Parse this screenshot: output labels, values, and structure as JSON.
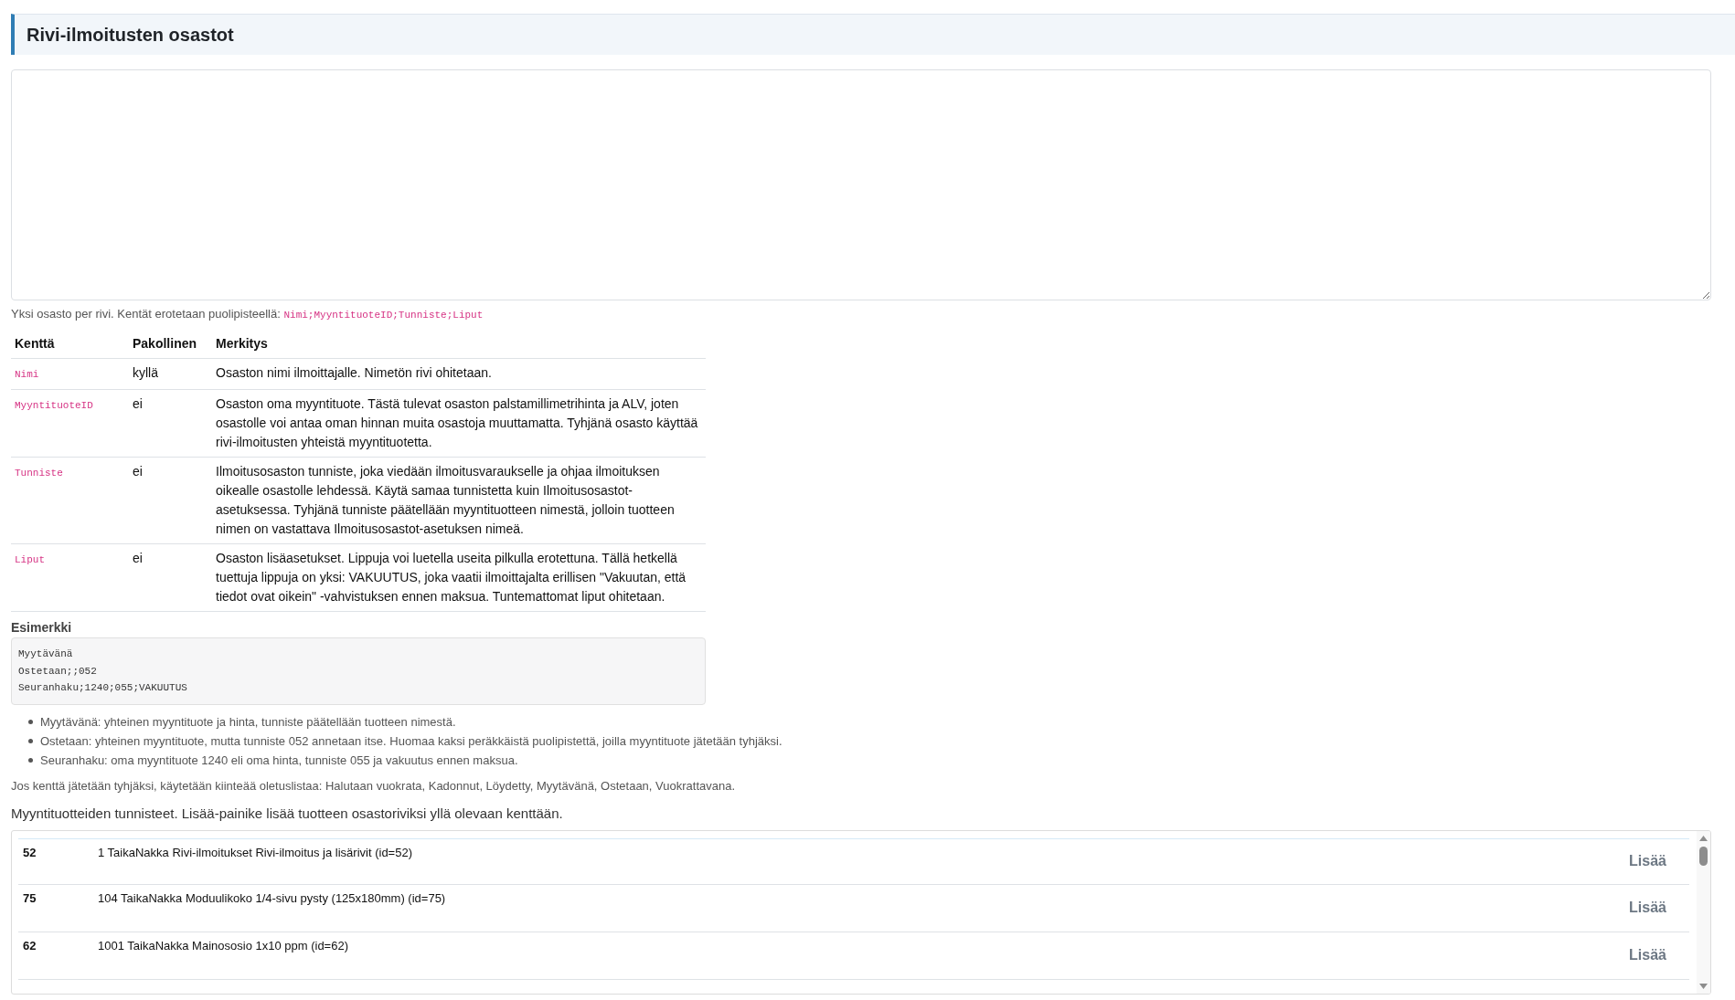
{
  "header": {
    "title": "Rivi-ilmoitusten osastot"
  },
  "help": {
    "text": "Yksi osasto per rivi. Kentät erotetaan puolipisteellä:",
    "code": "Nimi;MyyntituoteID;Tunniste;Liput"
  },
  "fields_table": {
    "columns": [
      "Kenttä",
      "Pakollinen",
      "Merkitys"
    ],
    "rows": [
      {
        "field": "Nimi",
        "required": "kyllä",
        "meaning": "Osaston nimi ilmoittajalle. Nimetön rivi ohitetaan."
      },
      {
        "field": "MyyntituoteID",
        "required": "ei",
        "meaning": "Osaston oma myyntituote. Tästä tulevat osaston palstamillimetrihinta ja ALV, joten osastolle voi antaa oman hinnan muita osastoja muuttamatta. Tyhjänä osasto käyttää rivi-ilmoitusten yhteistä myyntituotetta."
      },
      {
        "field": "Tunniste",
        "required": "ei",
        "meaning": "Ilmoitusosaston tunniste, joka viedään ilmoitusvaraukselle ja ohjaa ilmoituksen oikealle osastolle lehdessä. Käytä samaa tunnistetta kuin Ilmoitusosastot-asetuksessa. Tyhjänä tunniste päätellään myyntituotteen nimestä, jolloin tuotteen nimen on vastattava Ilmoitusosastot-asetuksen nimeä."
      },
      {
        "field": "Liput",
        "required": "ei",
        "meaning": "Osaston lisäasetukset. Lippuja voi luetella useita pilkulla erotettuna. Tällä hetkellä tuettuja lippuja on yksi: VAKUUTUS, joka vaatii ilmoittajalta erillisen \"Vakuutan, että tiedot ovat oikein\" -vahvistuksen ennen maksua. Tuntemattomat liput ohitetaan."
      }
    ]
  },
  "example": {
    "label": "Esimerkki",
    "lines": [
      "Myytävänä",
      "Ostetaan;;052",
      "Seuranhaku;1240;055;VAKUUTUS"
    ]
  },
  "notes": [
    "Myytävänä: yhteinen myyntituote ja hinta, tunniste päätellään tuotteen nimestä.",
    "Ostetaan: yhteinen myyntituote, mutta tunniste 052 annetaan itse. Huomaa kaksi peräkkäistä puolipistettä, joilla myyntituote jätetään tyhjäksi.",
    "Seuranhaku: oma myyntituote 1240 eli oma hinta, tunniste 055 ja vakuutus ennen maksua."
  ],
  "default_note": "Jos kenttä jätetään tyhjäksi, käytetään kiinteää oletuslistaa: Halutaan vuokrata, Kadonnut, Löydetty, Myytävänä, Ostetaan, Vuokrattavana.",
  "products": {
    "intro": "Myyntituotteiden tunnisteet. Lisää-painike lisää tuotteen osastoriviksi yllä olevaan kenttään.",
    "rows": [
      {
        "id": "52",
        "name": "1 TaikaNakka Rivi-ilmoitukset Rivi-ilmoitus ja lisärivit (id=52)",
        "button": "Lisää"
      },
      {
        "id": "75",
        "name": "104 TaikaNakka Moduulikoko 1/4-sivu pysty (125x180mm) (id=75)",
        "button": "Lisää"
      },
      {
        "id": "62",
        "name": "1001 TaikaNakka Mainososio 1x10 ppm (id=62)",
        "button": "Lisää"
      }
    ]
  }
}
